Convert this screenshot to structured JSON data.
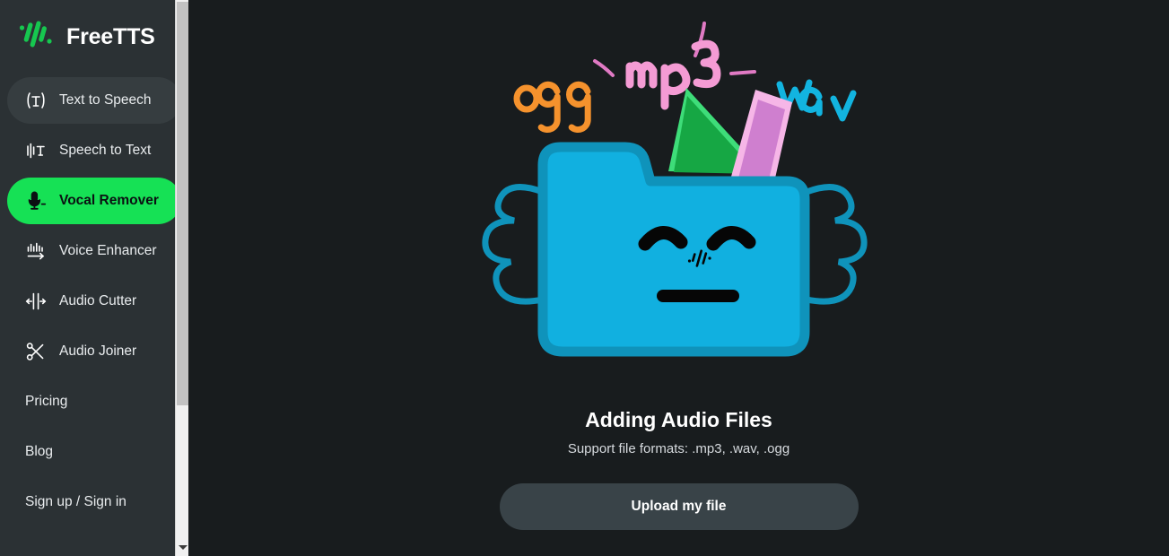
{
  "brand": {
    "name": "FreeTTS",
    "logo_icon": "freetts-waveform-logo"
  },
  "sidebar": {
    "tools": [
      {
        "label": "Text to Speech",
        "icon": "text-to-speech-icon",
        "state": "hover"
      },
      {
        "label": "Speech to Text",
        "icon": "speech-to-text-icon",
        "state": "default"
      },
      {
        "label": "Vocal Remover",
        "icon": "vocal-remover-mic-icon",
        "state": "selected"
      },
      {
        "label": "Voice Enhancer",
        "icon": "voice-enhancer-icon",
        "state": "default"
      },
      {
        "label": "Audio Cutter",
        "icon": "audio-cutter-icon",
        "state": "default"
      },
      {
        "label": "Audio Joiner",
        "icon": "audio-joiner-scissors-icon",
        "state": "default"
      }
    ],
    "links": [
      {
        "label": "Pricing"
      },
      {
        "label": "Blog"
      },
      {
        "label": "Sign up / Sign in"
      }
    ],
    "scrollbar": {
      "down_arrow_icon": "chevron-down-icon"
    }
  },
  "main": {
    "illustration": {
      "name": "smiling-folder-with-audio-files",
      "labels": [
        {
          "text": "ogg",
          "color": "#f5922d"
        },
        {
          "text": "mp3",
          "color": "#f49bd4"
        },
        {
          "text": "wav",
          "color": "#12b4e0"
        }
      ],
      "folder_color": "#11b0e0",
      "paper_green": "#16a744",
      "paper_pink": "#cf7fcf"
    },
    "title": "Adding Audio Files",
    "subtitle": "Support file formats: .mp3, .wav, .ogg",
    "upload_button": "Upload my file"
  },
  "colors": {
    "sidebar_bg": "#2b3134",
    "main_bg": "#181c1e",
    "accent_green": "#16e155",
    "button_bg": "#394348"
  }
}
